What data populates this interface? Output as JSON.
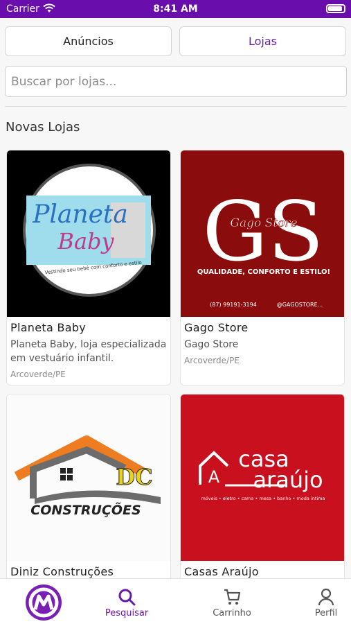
{
  "status_bar": {
    "carrier": "Carrier",
    "time": "8:41 AM"
  },
  "segments": {
    "ads": "Anúncios",
    "stores": "Lojas"
  },
  "search": {
    "placeholder": "Buscar por lojas..."
  },
  "section_title": "Novas Lojas",
  "stores": [
    {
      "name": "Planeta Baby",
      "description": "Planeta Baby, loja especializada em vestuário infantil.",
      "location": "Arcoverde/PE",
      "logo": {
        "line1": "Planeta",
        "line2": "Baby",
        "tagline": "Vestindo seu bebê com conforto e estilo"
      }
    },
    {
      "name": "Gago Store",
      "description": "Gago Store",
      "location": "Arcoverde/PE",
      "logo": {
        "letters": "GS",
        "script": "Gago Store",
        "slogan": "QUALIDADE, CONFORTO E ESTILO!",
        "phone": "(87) 99191-3194",
        "handle": "@GAGOSTORE..."
      }
    },
    {
      "name": "Diniz Construções",
      "logo": {
        "initials": "DC",
        "wordmark": "CONSTRUÇÕES"
      }
    },
    {
      "name": "Casas Araújo",
      "logo": {
        "casa": "casa",
        "araujo": "araújo",
        "letter": "A",
        "tagline": "móveis • eletro • cama • mesa • banho • moda íntima"
      }
    }
  ],
  "tabs": {
    "search": "Pesquisar",
    "cart": "Carrinho",
    "profile": "Perfil"
  },
  "colors": {
    "brand": "#6a0dad",
    "accent_purple": "#6a1aa8",
    "gago_red": "#8b0c0c",
    "araujo_red": "#c8101e"
  }
}
